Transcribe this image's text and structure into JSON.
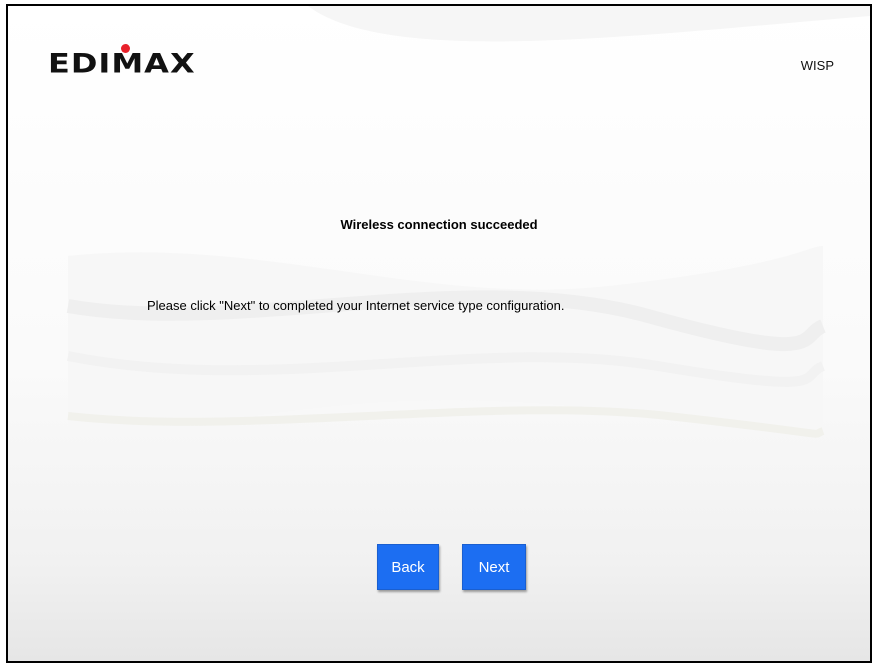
{
  "header": {
    "logo_text": "EDIMAX",
    "mode_label": "WISP"
  },
  "main": {
    "headline": "Wireless connection succeeded",
    "message": "Please click \"Next\" to completed your Internet service type configuration."
  },
  "buttons": {
    "back_label": "Back",
    "next_label": "Next"
  },
  "colors": {
    "button_blue": "#1c6ef2",
    "logo_dot_red": "#e8202a",
    "border": "#000000"
  }
}
